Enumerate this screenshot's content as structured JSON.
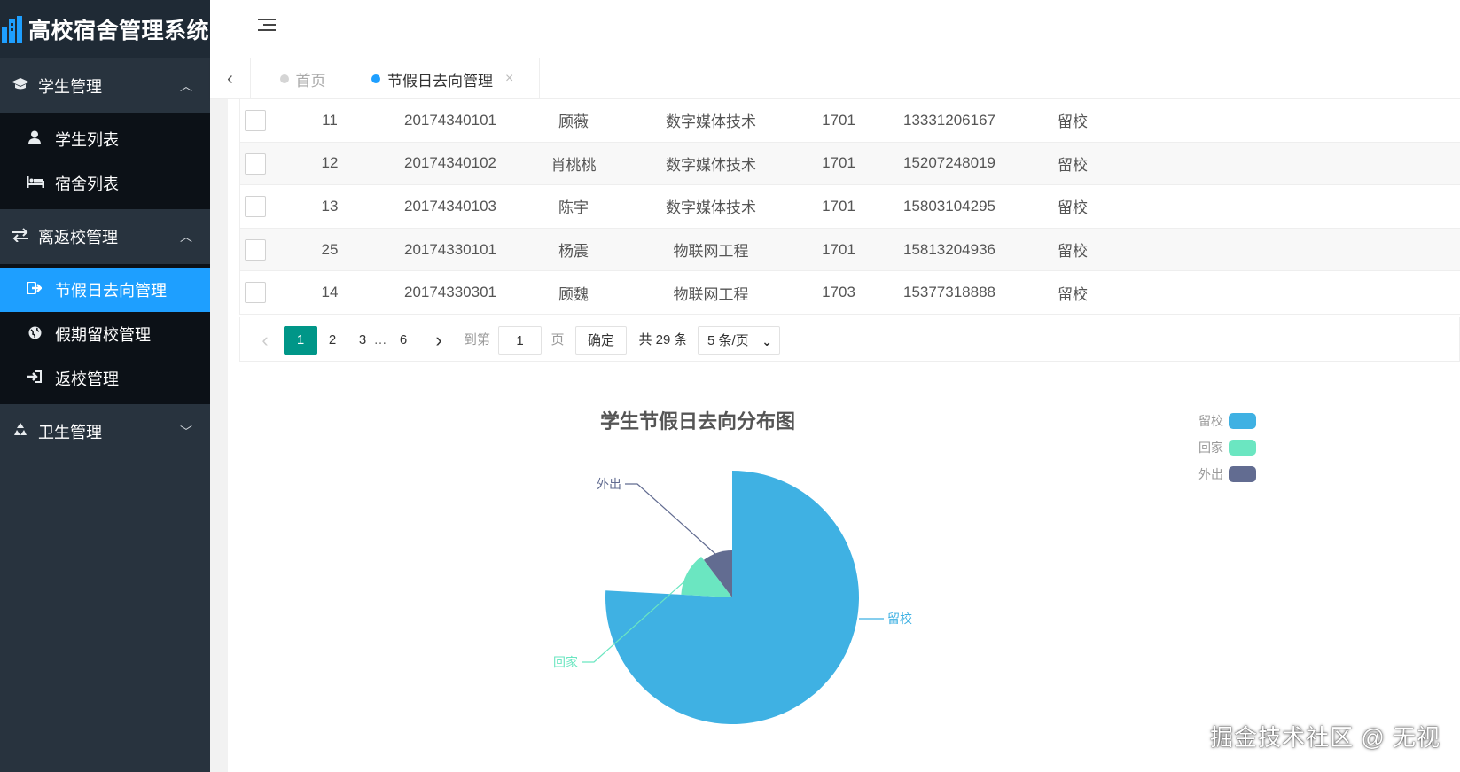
{
  "app": {
    "title": "高校宿舍管理系统"
  },
  "sidebar": {
    "groups": [
      {
        "label": "学生管理",
        "icon": "graduation-cap-icon",
        "expanded": true,
        "items": [
          {
            "label": "学生列表",
            "icon": "user-icon"
          },
          {
            "label": "宿舍列表",
            "icon": "bed-icon"
          }
        ]
      },
      {
        "label": "离返校管理",
        "icon": "exchange-icon",
        "expanded": true,
        "items": [
          {
            "label": "节假日去向管理",
            "icon": "sign-out-icon",
            "active": true
          },
          {
            "label": "假期留校管理",
            "icon": "globe-icon"
          },
          {
            "label": "返校管理",
            "icon": "sign-in-icon"
          }
        ]
      },
      {
        "label": "卫生管理",
        "icon": "recycle-icon",
        "expanded": false,
        "items": []
      }
    ]
  },
  "tabs": [
    {
      "label": "首页",
      "active": false
    },
    {
      "label": "节假日去向管理",
      "active": true,
      "close": "×"
    }
  ],
  "table": {
    "rows": [
      [
        "11",
        "20174340101",
        "顾薇",
        "数字媒体技术",
        "1701",
        "13331206167",
        "留校"
      ],
      [
        "12",
        "20174340102",
        "肖桃桃",
        "数字媒体技术",
        "1701",
        "15207248019",
        "留校"
      ],
      [
        "13",
        "20174340103",
        "陈宇",
        "数字媒体技术",
        "1701",
        "15803104295",
        "留校"
      ],
      [
        "25",
        "20174330101",
        "杨震",
        "物联网工程",
        "1701",
        "15813204936",
        "留校"
      ],
      [
        "14",
        "20174330301",
        "顾魏",
        "物联网工程",
        "1703",
        "15377318888",
        "留校"
      ]
    ]
  },
  "pager": {
    "prev": "‹",
    "current": "1",
    "p2": "2",
    "p3": "3",
    "ellipsis": "…",
    "last": "6",
    "next": "›",
    "goto_label": "到第",
    "goto_value": "1",
    "page_label": "页",
    "confirm": "确定",
    "total": "共 29 条",
    "page_size": "5 条/页"
  },
  "chart_data": {
    "type": "pie",
    "title": "学生节假日去向分布图",
    "roseType": "radius",
    "legend_position": "top-right",
    "series": [
      {
        "name": "留校",
        "value": 22,
        "color": "#3fb1e3"
      },
      {
        "name": "回家",
        "value": 4,
        "color": "#6be6c1"
      },
      {
        "name": "外出",
        "value": 3,
        "color": "#626c91"
      }
    ]
  },
  "watermark": "掘金技术社区 @ 无视"
}
